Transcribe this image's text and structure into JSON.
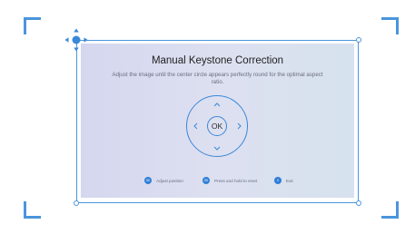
{
  "screen": {
    "title": "Manual Keystone Correction",
    "description": "Adjust the image until the center circle appears perfectly round for the optimal aspect ratio."
  },
  "dpad": {
    "center_label": "OK",
    "icons": [
      "chevron-up-icon",
      "chevron-down-icon",
      "chevron-left-icon",
      "chevron-right-icon"
    ]
  },
  "hints": [
    {
      "badge": "OK",
      "label": "Adjust position"
    },
    {
      "badge": "OK",
      "label": "Press and hold to reset"
    },
    {
      "badge": "X",
      "label": "Exit"
    }
  ],
  "colors": {
    "accent": "#3a88d8",
    "frame": "#4a95dc",
    "badge": "#2f7fd6"
  }
}
